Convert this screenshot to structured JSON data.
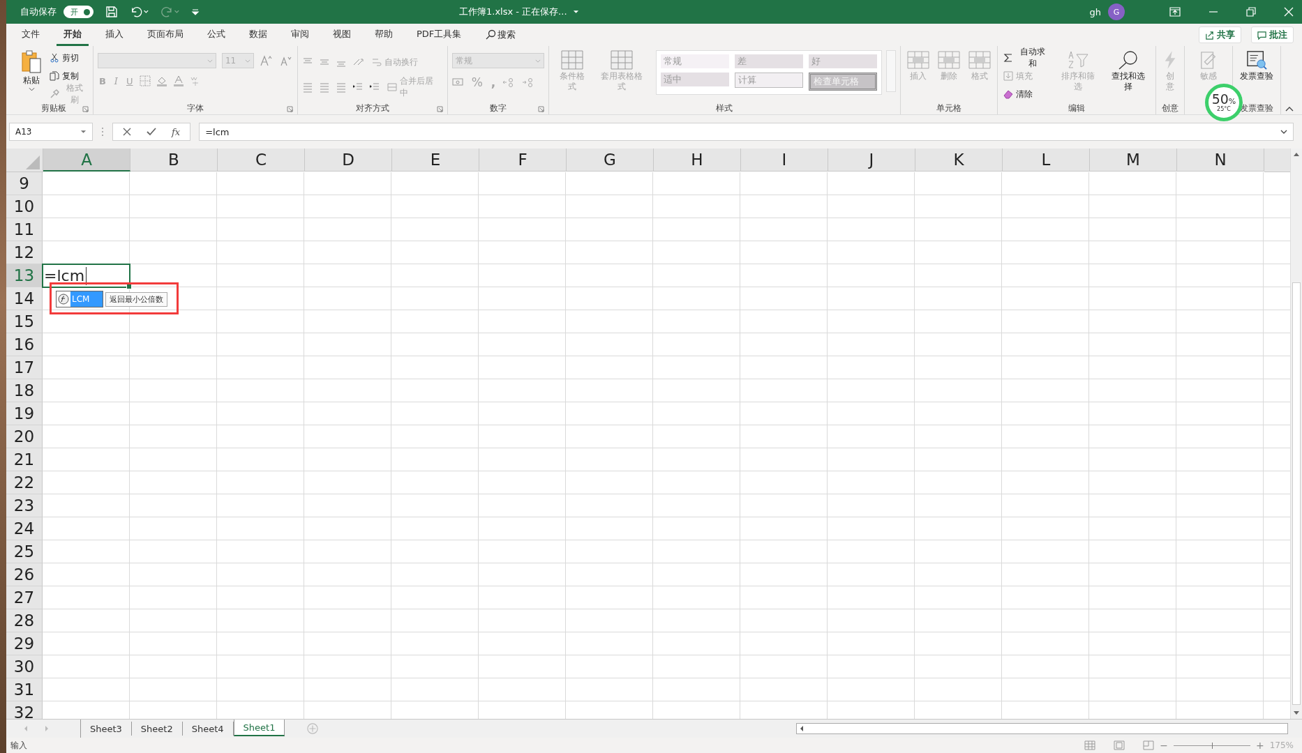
{
  "title_bar": {
    "autosave_label": "自动保存",
    "autosave": {
      "label": "开",
      "on": true
    },
    "title": "工作簿1.xlsx - 正在保存...",
    "user": "gh",
    "avatar": "G"
  },
  "menu_tabs": [
    {
      "label": "文件",
      "selected": false
    },
    {
      "label": "开始",
      "selected": true
    },
    {
      "label": "插入",
      "selected": false
    },
    {
      "label": "页面布局",
      "selected": false
    },
    {
      "label": "公式",
      "selected": false
    },
    {
      "label": "数据",
      "selected": false
    },
    {
      "label": "审阅",
      "selected": false
    },
    {
      "label": "视图",
      "selected": false
    },
    {
      "label": "帮助",
      "selected": false
    },
    {
      "label": "PDF工具集",
      "selected": false
    }
  ],
  "search": {
    "label": "搜索"
  },
  "share_button": "共享",
  "comments_button": "批注",
  "ribbon": [
    {
      "kind": "clipboard",
      "label": "剪贴板",
      "paste": "粘贴",
      "items": [
        {
          "label": "剪切",
          "disabled": false
        },
        {
          "label": "复制",
          "disabled": false
        },
        {
          "label": "格式刷",
          "disabled": true
        }
      ]
    },
    {
      "kind": "font",
      "label": "字体",
      "size": "11",
      "bold": "B",
      "italic": "I",
      "underline": "U"
    },
    {
      "kind": "alignment",
      "label": "对齐方式",
      "wrap": "自动换行",
      "merge": "合并后居中"
    },
    {
      "kind": "number",
      "label": "数字",
      "format": "常规",
      "percent": "%",
      "comma": ","
    },
    {
      "kind": "styles",
      "label": "样式",
      "buttons": [
        "条件格式",
        "套用表格格式"
      ],
      "cells": [
        {
          "label": "常规"
        },
        {
          "label": "差"
        },
        {
          "label": "好"
        },
        {
          "label": "适中"
        },
        {
          "label": "计算"
        },
        {
          "label": "检查单元格"
        }
      ]
    },
    {
      "kind": "cells",
      "label": "单元格",
      "buttons": [
        "插入",
        "删除",
        "格式"
      ]
    },
    {
      "kind": "editing",
      "label": "编辑",
      "items": [
        {
          "label": "自动求和",
          "disabled": false
        },
        {
          "label": "填充",
          "disabled": true
        },
        {
          "label": "清除",
          "disabled": false
        }
      ],
      "buttons": [
        {
          "label": "排序和筛选",
          "disabled": true
        },
        {
          "label": "查找和选择",
          "disabled": false
        }
      ]
    },
    {
      "kind": "single",
      "label": "创意",
      "button": {
        "label": "创意",
        "disabled": true,
        "narrow": true
      }
    },
    {
      "kind": "single",
      "button": {
        "label": "敏感",
        "disabled": true,
        "narrow": false
      }
    },
    {
      "kind": "single",
      "label": "发票查验",
      "button": {
        "label": "发票查验",
        "disabled": false,
        "narrow": false
      }
    }
  ],
  "overlay_meter": {
    "reading": "50",
    "unit": "%",
    "temperature": "25°C"
  },
  "name_box": "A13",
  "function_button": "fx",
  "formula": "=lcm",
  "columns": [
    {
      "label": "A",
      "selected": true
    },
    {
      "label": "B",
      "selected": false
    },
    {
      "label": "C",
      "selected": false
    },
    {
      "label": "D",
      "selected": false
    },
    {
      "label": "E",
      "selected": false
    },
    {
      "label": "F",
      "selected": false
    },
    {
      "label": "G",
      "selected": false
    },
    {
      "label": "H",
      "selected": false
    },
    {
      "label": "I",
      "selected": false
    },
    {
      "label": "J",
      "selected": false
    },
    {
      "label": "K",
      "selected": false
    },
    {
      "label": "L",
      "selected": false
    },
    {
      "label": "M",
      "selected": false
    },
    {
      "label": "N",
      "selected": false
    }
  ],
  "rows": [
    {
      "label": "9",
      "selected": false
    },
    {
      "label": "10",
      "selected": false
    },
    {
      "label": "11",
      "selected": false
    },
    {
      "label": "12",
      "selected": false
    },
    {
      "label": "13",
      "selected": true,
      "value": "=lcm"
    },
    {
      "label": "14",
      "selected": false
    },
    {
      "label": "15",
      "selected": false
    },
    {
      "label": "16",
      "selected": false
    },
    {
      "label": "17",
      "selected": false
    },
    {
      "label": "18",
      "selected": false
    },
    {
      "label": "19",
      "selected": false
    },
    {
      "label": "20",
      "selected": false
    },
    {
      "label": "21",
      "selected": false
    },
    {
      "label": "22",
      "selected": false
    },
    {
      "label": "23",
      "selected": false
    },
    {
      "label": "24",
      "selected": false
    },
    {
      "label": "25",
      "selected": false
    },
    {
      "label": "26",
      "selected": false
    },
    {
      "label": "27",
      "selected": false
    },
    {
      "label": "28",
      "selected": false
    },
    {
      "label": "29",
      "selected": false
    },
    {
      "label": "30",
      "selected": false
    },
    {
      "label": "31",
      "selected": false
    },
    {
      "label": "32",
      "selected": false
    }
  ],
  "autocomplete": {
    "function": "LCM",
    "description": "返回最小公倍数"
  },
  "sheet_tabs": [
    {
      "label": "Sheet3",
      "selected": false
    },
    {
      "label": "Sheet2",
      "selected": false
    },
    {
      "label": "Sheet4",
      "selected": false
    },
    {
      "label": "Sheet1",
      "selected": true
    }
  ],
  "status": "输入",
  "zoom_slider": {
    "minus": "−",
    "plus": "+",
    "level": 0.5
  },
  "zoom": "175%"
}
